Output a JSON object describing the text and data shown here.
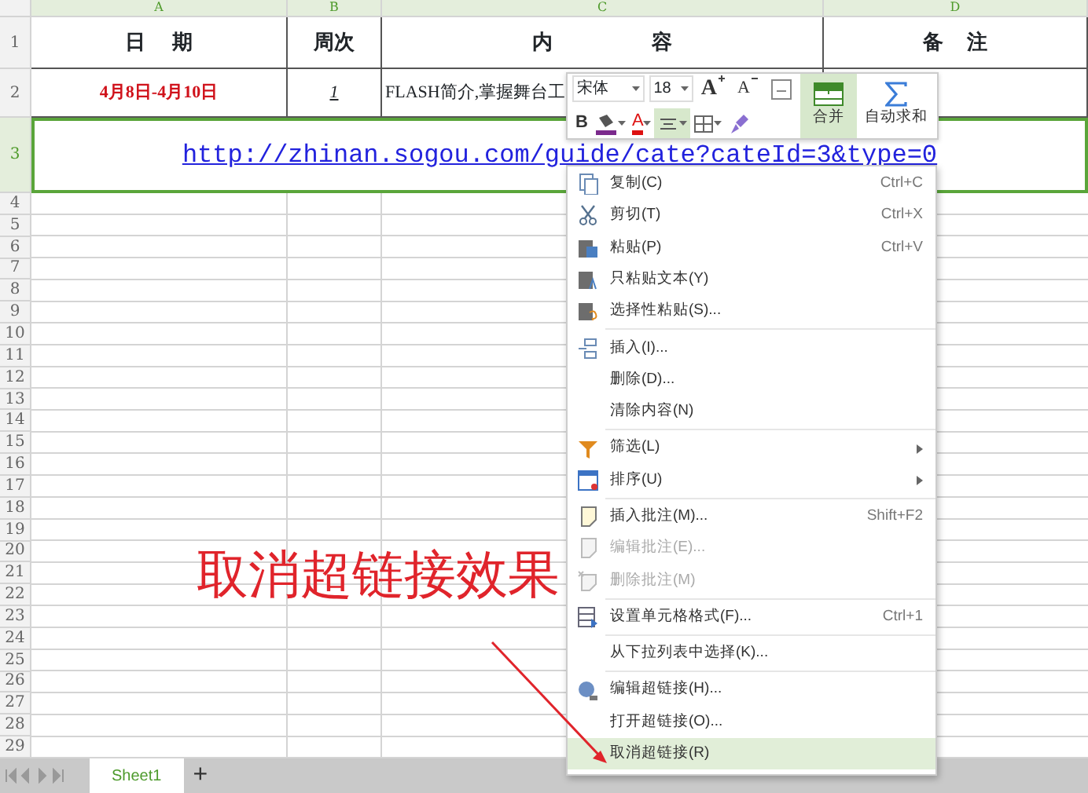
{
  "sheet": {
    "columns": [
      {
        "label": "A",
        "selected": true
      },
      {
        "label": "B",
        "selected": true
      },
      {
        "label": "C",
        "selected": true
      },
      {
        "label": "D",
        "selected": true
      }
    ],
    "row_headers": [
      {
        "label": "1",
        "selected": false
      },
      {
        "label": "2",
        "selected": false
      },
      {
        "label": "3",
        "selected": true
      },
      {
        "label": "4",
        "selected": false
      },
      {
        "label": "5",
        "selected": false
      },
      {
        "label": "6",
        "selected": false
      },
      {
        "label": "7",
        "selected": false
      },
      {
        "label": "8",
        "selected": false
      },
      {
        "label": "9",
        "selected": false
      },
      {
        "label": "10",
        "selected": false
      },
      {
        "label": "11",
        "selected": false
      },
      {
        "label": "12",
        "selected": false
      },
      {
        "label": "13",
        "selected": false
      },
      {
        "label": "14",
        "selected": false
      },
      {
        "label": "15",
        "selected": false
      },
      {
        "label": "16",
        "selected": false
      },
      {
        "label": "17",
        "selected": false
      },
      {
        "label": "18",
        "selected": false
      },
      {
        "label": "19",
        "selected": false
      },
      {
        "label": "20",
        "selected": false
      },
      {
        "label": "21",
        "selected": false
      },
      {
        "label": "22",
        "selected": false
      },
      {
        "label": "23",
        "selected": false
      },
      {
        "label": "24",
        "selected": false
      },
      {
        "label": "25",
        "selected": false
      },
      {
        "label": "26",
        "selected": false
      },
      {
        "label": "27",
        "selected": false
      },
      {
        "label": "28",
        "selected": false
      },
      {
        "label": "29",
        "selected": false
      }
    ],
    "header_row": [
      "日 期",
      "周次",
      "内 容",
      "备 注"
    ],
    "row_2": {
      "date": "4月8日-4月10日",
      "week": "1",
      "content": "FLASH简介,掌握舞台工"
    },
    "row_3": {
      "link": "http://zhinan.sogou.com/guide/cate?cateId=3&type=0"
    }
  },
  "mini_toolbar": {
    "font": "宋体",
    "size": "18",
    "buttons": [
      {
        "kind": "grow",
        "label": "A",
        "selected": false
      },
      {
        "kind": "shrink",
        "label": "A",
        "selected": false
      },
      {
        "kind": "wrap",
        "selected": false
      },
      {
        "kind": "bold",
        "label": "B",
        "selected": false
      },
      {
        "kind": "fill",
        "selected": false
      },
      {
        "kind": "color",
        "label": "A",
        "selected": false
      },
      {
        "kind": "align",
        "selected": true
      },
      {
        "kind": "border",
        "selected": false
      },
      {
        "kind": "brush",
        "selected": false
      }
    ],
    "merge": {
      "label": "合并",
      "selected": true
    },
    "autosum": {
      "label": "自动求和",
      "selected": false
    }
  },
  "context_menu": [
    {
      "label": "复制(C)",
      "shortcut": "Ctrl+C",
      "kind": "copy",
      "disabled": false,
      "submenu": false,
      "selected": false,
      "separator_before": false
    },
    {
      "label": "剪切(T)",
      "shortcut": "Ctrl+X",
      "kind": "cut",
      "disabled": false,
      "submenu": false,
      "selected": false,
      "separator_before": false
    },
    {
      "label": "粘贴(P)",
      "shortcut": "Ctrl+V",
      "kind": "paste",
      "disabled": false,
      "submenu": false,
      "selected": false,
      "separator_before": false
    },
    {
      "label": "只粘贴文本(Y)",
      "kind": "paste-text",
      "disabled": false,
      "submenu": false,
      "selected": false,
      "separator_before": false
    },
    {
      "label": "选择性粘贴(S)...",
      "kind": "paste-special",
      "disabled": false,
      "submenu": false,
      "selected": false,
      "separator_before": false
    },
    {
      "label": "插入(I)...",
      "kind": "insert",
      "disabled": false,
      "submenu": false,
      "selected": false,
      "separator_before": true
    },
    {
      "label": "删除(D)...",
      "disabled": false,
      "submenu": false,
      "selected": false,
      "separator_before": false
    },
    {
      "label": "清除内容(N)",
      "disabled": false,
      "submenu": false,
      "selected": false,
      "separator_before": false
    },
    {
      "label": "筛选(L)",
      "kind": "filter",
      "disabled": false,
      "submenu": true,
      "selected": false,
      "separator_before": true
    },
    {
      "label": "排序(U)",
      "kind": "sort",
      "disabled": false,
      "submenu": true,
      "selected": false,
      "separator_before": false
    },
    {
      "label": "插入批注(M)...",
      "shortcut": "Shift+F2",
      "kind": "note",
      "disabled": false,
      "submenu": false,
      "selected": false,
      "separator_before": true
    },
    {
      "label": "编辑批注(E)...",
      "kind": "note-edit",
      "disabled": true,
      "submenu": false,
      "selected": false,
      "separator_before": false
    },
    {
      "label": "删除批注(M)",
      "kind": "note-delete",
      "disabled": true,
      "submenu": false,
      "selected": false,
      "separator_before": false
    },
    {
      "label": "设置单元格格式(F)...",
      "shortcut": "Ctrl+1",
      "kind": "format",
      "disabled": false,
      "submenu": false,
      "selected": false,
      "separator_before": true
    },
    {
      "label": "从下拉列表中选择(K)...",
      "disabled": false,
      "submenu": false,
      "selected": false,
      "separator_before": true
    },
    {
      "label": "编辑超链接(H)...",
      "kind": "link",
      "disabled": false,
      "submenu": false,
      "selected": false,
      "separator_before": true
    },
    {
      "label": "打开超链接(O)...",
      "disabled": false,
      "submenu": false,
      "selected": false,
      "separator_before": false
    },
    {
      "label": "取消超链接(R)",
      "disabled": false,
      "submenu": false,
      "selected": true,
      "separator_before": false
    }
  ],
  "annotation": {
    "text": "取消超链接效果"
  },
  "sheet_tabs": [
    {
      "label": "Sheet1",
      "selected": true
    }
  ],
  "add_sheet": "+"
}
